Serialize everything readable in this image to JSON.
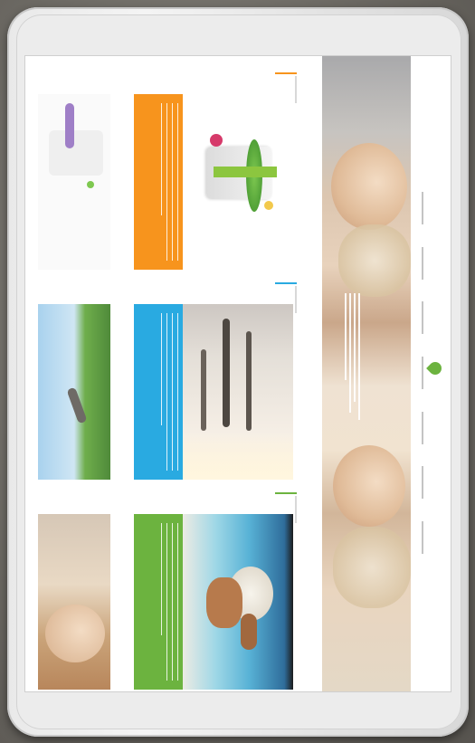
{
  "device": {
    "type": "tablet",
    "orientation": "landscape-content-rotated"
  },
  "site": {
    "logo_icon": "leaf-icon",
    "logo_text": "",
    "hero_image": "woman-smiling-portrait"
  },
  "cards": [
    {
      "accent": "#f7941d",
      "image": "product-jar-with-herbs"
    },
    {
      "accent": "#29aae1",
      "image": "people-walking-on-beach"
    },
    {
      "accent": "#6cb33f",
      "image": "woman-in-sun-hat-at-sea"
    }
  ],
  "colors": {
    "green": "#6cb33f",
    "blue": "#29aae1",
    "orange": "#f7941d"
  }
}
